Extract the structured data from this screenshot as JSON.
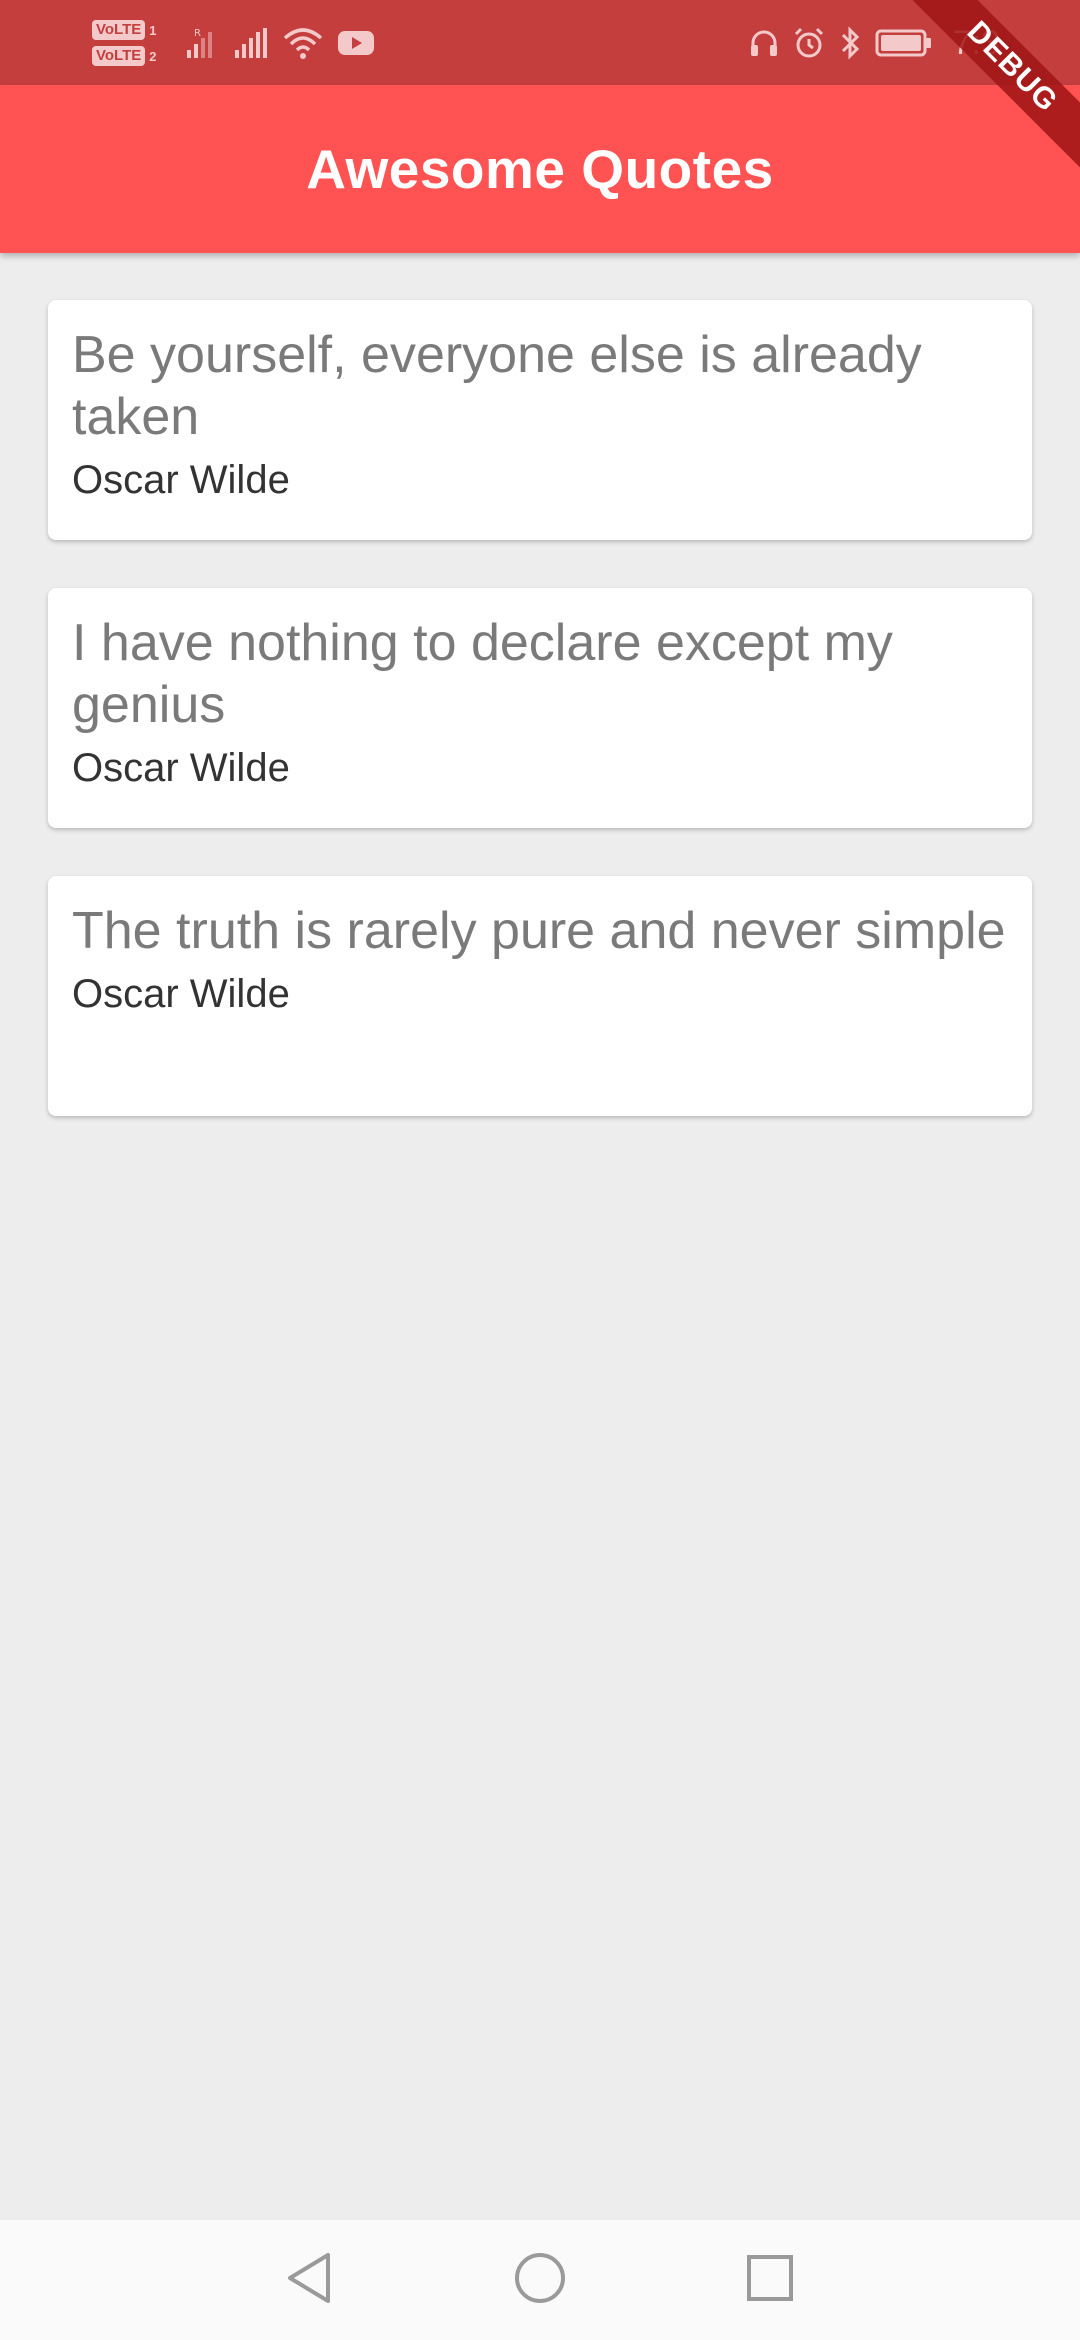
{
  "status_bar": {
    "volte_label": "VoLTE",
    "volte_1": "1",
    "volte_2": "2",
    "signal_1_label": "R",
    "time": "7:3"
  },
  "app_bar": {
    "title": "Awesome Quotes"
  },
  "debug_banner": {
    "label": "DEBUG"
  },
  "quotes": [
    {
      "text": "Be yourself, everyone else is already taken",
      "author": "Oscar Wilde"
    },
    {
      "text": "I have nothing to declare except my genius",
      "author": "Oscar Wilde"
    },
    {
      "text": "The truth is rarely pure and never simple",
      "author": "Oscar Wilde"
    }
  ],
  "nav_bar": {
    "back": "back-icon",
    "home": "home-icon",
    "recents": "recents-icon"
  },
  "colors": {
    "status_bar": "#c43e3e",
    "app_bar": "#ff5353",
    "background": "#ededed",
    "card": "#ffffff"
  }
}
